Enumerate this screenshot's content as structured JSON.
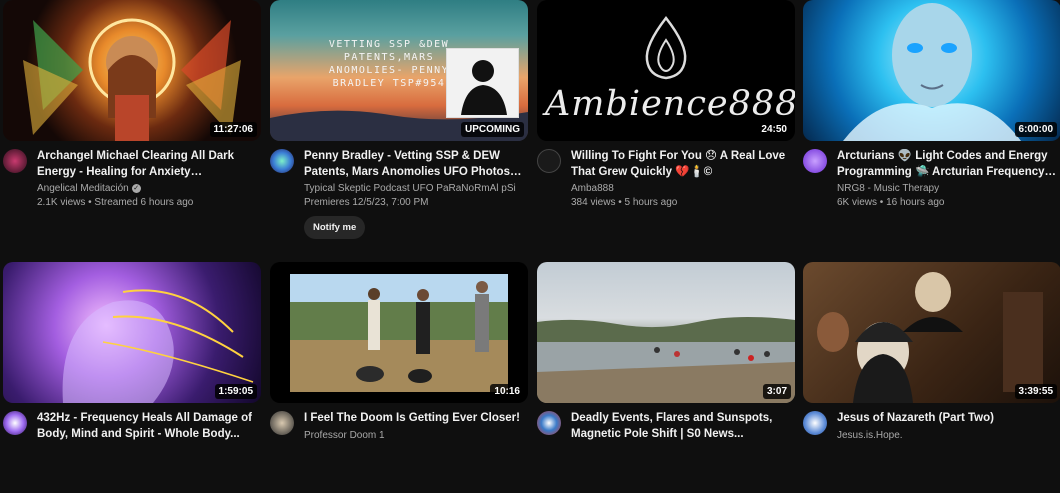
{
  "videos": [
    {
      "title": "Archangel Michael Clearing All Dark Energy - Healing for Anxiety Disorders,...",
      "channel": "Angelical Meditación",
      "stats": "2.1K views • Streamed 6 hours ago",
      "duration": "11:27:06",
      "verified": true
    },
    {
      "title": "Penny Bradley - Vetting SSP & DEW Patents, Mars Anomolies UFO Photos -...",
      "channel": "Typical Skeptic Podcast UFO PaRaNoRmAl pSi",
      "stats": "Premieres 12/5/23, 7:00 PM",
      "duration": "UPCOMING",
      "thumb_text": "VETTING SSP &DEW PATENTS,MARS ANOMOLIES- PENNY BRADLEY TSP#954",
      "action": "Notify me"
    },
    {
      "title": "Willing To Fight For You 😞 A Real Love That Grew Quickly 💔🕯️©",
      "channel": "Amba888",
      "stats": "384 views • 5 hours ago",
      "duration": "24:50",
      "thumb_text": "Ambience888"
    },
    {
      "title": "Arcturians 👽 Light Codes and Energy Programming 🛸 Arcturian Frequency ...",
      "channel": "NRG8 - Music Therapy",
      "stats": "6K views • 16 hours ago",
      "duration": "6:00:00"
    },
    {
      "title": "432Hz - Frequency Heals All Damage of Body, Mind and Spirit - Whole Body...",
      "duration": "1:59:05"
    },
    {
      "title": "I Feel The Doom Is Getting Ever Closer!",
      "channel": "Professor Doom 1",
      "duration": "10:16"
    },
    {
      "title": "Deadly Events, Flares and Sunspots, Magnetic Pole Shift | S0 News...",
      "duration": "3:07"
    },
    {
      "title": "Jesus of Nazareth (Part Two)",
      "channel": "Jesus.is.Hope.",
      "duration": "3:39:55"
    }
  ]
}
